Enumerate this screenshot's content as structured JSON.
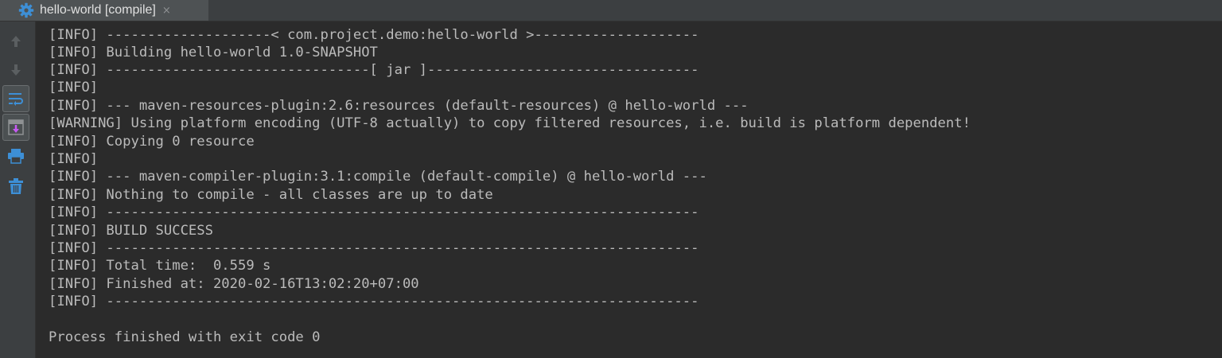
{
  "tab": {
    "title": "hello-world [compile]",
    "close_glyph": "×",
    "icon": "gear-icon",
    "icon_color": "#3d8fd6"
  },
  "toolbar": {
    "items": [
      {
        "name": "up-arrow-icon"
      },
      {
        "name": "down-arrow-icon"
      },
      {
        "name": "soft-wrap-icon"
      },
      {
        "name": "scroll-to-end-icon"
      },
      {
        "name": "print-icon"
      },
      {
        "name": "trash-icon"
      }
    ]
  },
  "console": {
    "text_color": "#bbbbbb",
    "lines": [
      "[INFO] --------------------< com.project.demo:hello-world >--------------------",
      "[INFO] Building hello-world 1.0-SNAPSHOT",
      "[INFO] --------------------------------[ jar ]---------------------------------",
      "[INFO] ",
      "[INFO] --- maven-resources-plugin:2.6:resources (default-resources) @ hello-world ---",
      "[WARNING] Using platform encoding (UTF-8 actually) to copy filtered resources, i.e. build is platform dependent!",
      "[INFO] Copying 0 resource",
      "[INFO] ",
      "[INFO] --- maven-compiler-plugin:3.1:compile (default-compile) @ hello-world ---",
      "[INFO] Nothing to compile - all classes are up to date",
      "[INFO] ------------------------------------------------------------------------",
      "[INFO] BUILD SUCCESS",
      "[INFO] ------------------------------------------------------------------------",
      "[INFO] Total time:  0.559 s",
      "[INFO] Finished at: 2020-02-16T13:02:20+07:00",
      "[INFO] ------------------------------------------------------------------------",
      "",
      "Process finished with exit code 0"
    ]
  }
}
